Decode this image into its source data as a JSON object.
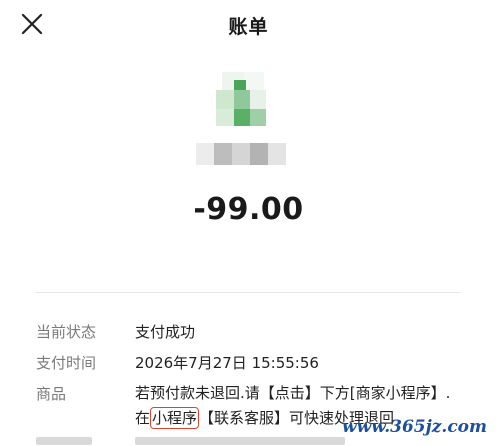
{
  "header": {
    "title": "账单",
    "close_icon": "close-icon"
  },
  "merchant": {
    "logo_icon": "merchant-logo-pixelated",
    "name_obscured": true
  },
  "amount": "-99.00",
  "details": [
    {
      "label": "当前状态",
      "value": "支付成功"
    },
    {
      "label": "支付时间",
      "value": "2026年7月27日 15:55:56"
    }
  ],
  "goods": {
    "label": "商品",
    "text_before": "若预付款未退回.请【点击】下方[商家小程序】. 在",
    "circled": "小程序",
    "text_after": "【联系客服】可快速处理退回"
  },
  "watermark": "www.365jz.com",
  "colors": {
    "circle_highlight": "#d8452f",
    "watermark": "#1c4f9c",
    "label": "#7a7a7a"
  }
}
